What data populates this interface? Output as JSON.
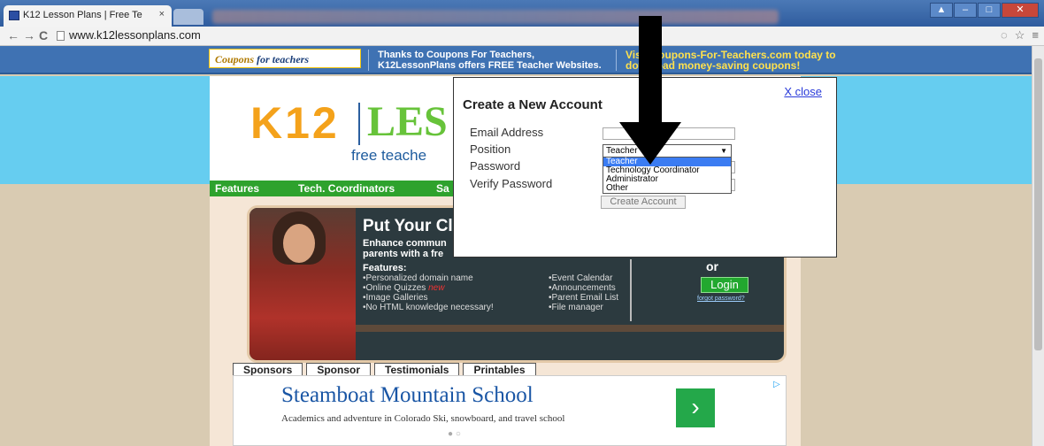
{
  "browser": {
    "tab_title": "K12 Lesson Plans | Free Te",
    "tab_close": "×",
    "url": "www.k12lessonplans.com"
  },
  "banner": {
    "logo_main": "Coupons",
    "logo_rest": "for teachers",
    "thanks": "Thanks to Coupons For Teachers, K12LessonPlans offers FREE Teacher Websites.",
    "visit": "Visit Coupons-For-Teachers.com today to download money-saving coupons!"
  },
  "site": {
    "logo_k12": "K12",
    "logo_les": "LES",
    "tagline": "free teache",
    "nav": [
      "Features",
      "Tech. Coordinators",
      "Sa"
    ],
    "hero": {
      "heading": "Put Your Cla",
      "enhance": "Enhance commun parents with a fre",
      "features_label": "Features:",
      "features_left": [
        "•Personalized domain name",
        "•Online Quizzes",
        "•Image Galleries",
        "•No HTML knowledge necessary!"
      ],
      "new_badge": "new",
      "features_right": [
        "•Event Calendar",
        "•Announcements",
        "•Parent Email List",
        "•File manager"
      ],
      "or": "or",
      "login": "Login",
      "forgot": "forgot password?"
    },
    "tabs": [
      "Sponsors",
      "Sponsor",
      "Testimonials",
      "Printables"
    ],
    "ad": {
      "title": "Steamboat Mountain School",
      "subtitle": "Academics and adventure in Colorado Ski, snowboard, and travel school",
      "go": "›",
      "choices": "▷"
    }
  },
  "modal": {
    "close": "X close",
    "title": "Create a New Account",
    "labels": {
      "email": "Email Address",
      "position": "Position",
      "password": "Password",
      "verify": "Verify Password"
    },
    "position_value": "Teacher",
    "options": [
      "Teacher",
      "Technology Coordinator",
      "Administrator",
      "Other"
    ],
    "submit": "Create Account"
  }
}
